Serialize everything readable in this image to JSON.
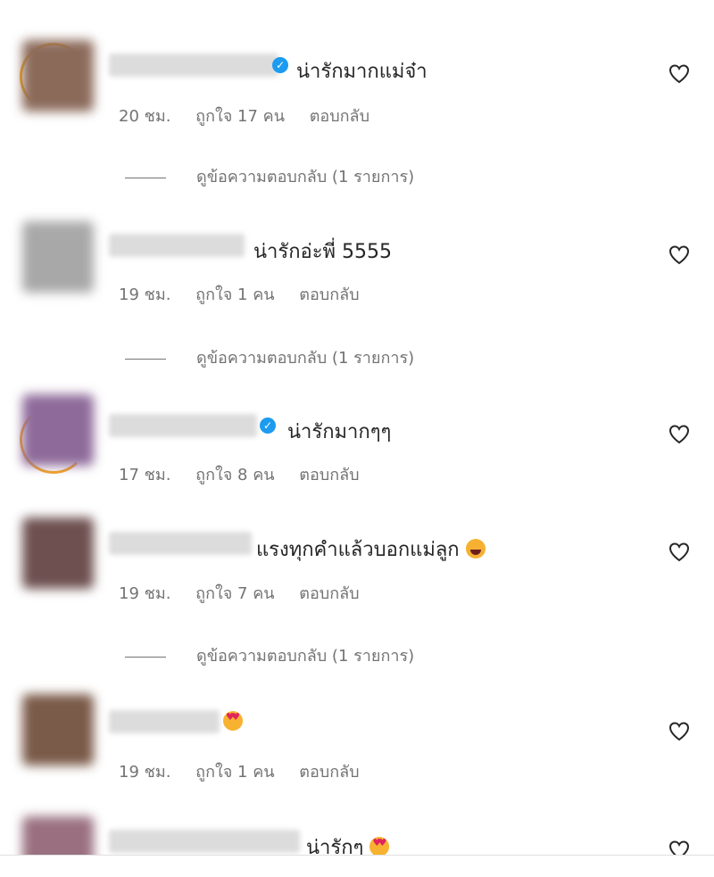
{
  "comments": [
    {
      "text": "น่ารักมากแม่จ๋า",
      "time": "20 ชม.",
      "likes": "ถูกใจ 17 คน",
      "reply": "ตอบกลับ",
      "replies": "ดูข้อความตอบกลับ (1 รายการ)",
      "verified": true
    },
    {
      "text": "น่ารักอ่ะพี่ 5555",
      "time": "19 ชม.",
      "likes": "ถูกใจ 1 คน",
      "reply": "ตอบกลับ",
      "replies": "ดูข้อความตอบกลับ (1 รายการ)",
      "verified": false
    },
    {
      "text": "น่ารักมากๆๆ",
      "time": "17 ชม.",
      "likes": "ถูกใจ 8 คน",
      "reply": "ตอบกลับ",
      "verified": true
    },
    {
      "text": "แรงทุกคำแล้วบอกแม่ลูก",
      "time": "19 ชม.",
      "likes": "ถูกใจ 7 คน",
      "reply": "ตอบกลับ",
      "replies": "ดูข้อความตอบกลับ (1 รายการ)",
      "verified": false,
      "emoji": "rolling-laughing-emoji"
    },
    {
      "text": "",
      "time": "19 ชม.",
      "likes": "ถูกใจ 1 คน",
      "reply": "ตอบกลับ",
      "verified": false,
      "emoji": "heart-eyes-emoji"
    },
    {
      "text": "น่ารักๆ",
      "verified": false,
      "emoji": "heart-eyes-emoji"
    }
  ],
  "colors": {
    "text": "#262626",
    "meta": "#737373",
    "verified": "#1d9bf0",
    "ring": "#f4a623"
  }
}
